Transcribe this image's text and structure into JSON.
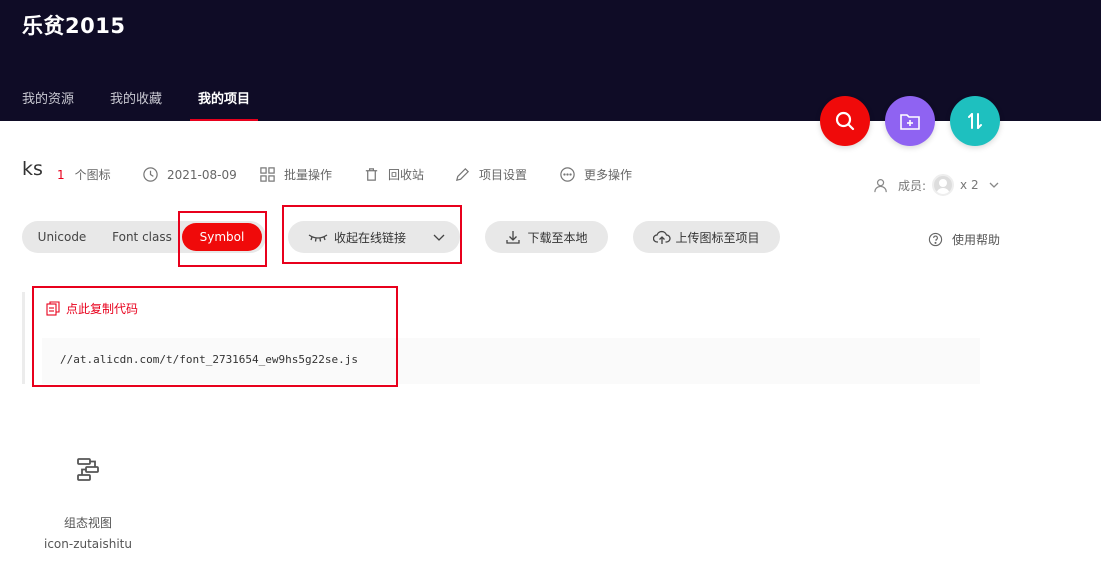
{
  "header": {
    "brand": "乐贫2015",
    "nav": [
      {
        "label": "我的资源"
      },
      {
        "label": "我的收藏"
      },
      {
        "label": "我的项目"
      }
    ]
  },
  "fabs": {
    "search_color": "#f00a0a",
    "add_folder_color": "#8f63f2",
    "sort_color": "#1ec0bf",
    "search_icon": "search-icon",
    "add_folder_icon": "folder-plus-icon",
    "sort_icon": "sort-icon"
  },
  "project": {
    "name": "ks",
    "icon_count": "1",
    "icon_count_unit": "个图标",
    "date": "2021-08-09",
    "batch": "批量操作",
    "recycle": "回收站",
    "settings": "项目设置",
    "more": "更多操作",
    "members_label": "成员:",
    "members_count": "x 2"
  },
  "toolbar": {
    "tabs": [
      "Unicode",
      "Font class",
      "Symbol"
    ],
    "active_tab": "Symbol",
    "collapse_link": "收起在线链接",
    "download": "下载至本地",
    "upload": "上传图标至项目",
    "help": "使用帮助"
  },
  "code": {
    "copy_label": "点此复制代码",
    "url": "//at.alicdn.com/t/font_2731654_ew9hs5g22se.js"
  },
  "icons": [
    {
      "name": "组态视图",
      "code": "icon-zutaishitu",
      "glyph": "flow-diagram-icon"
    }
  ],
  "colors": {
    "header_bg": "#0f0c26",
    "accent_red": "#e8001c"
  }
}
